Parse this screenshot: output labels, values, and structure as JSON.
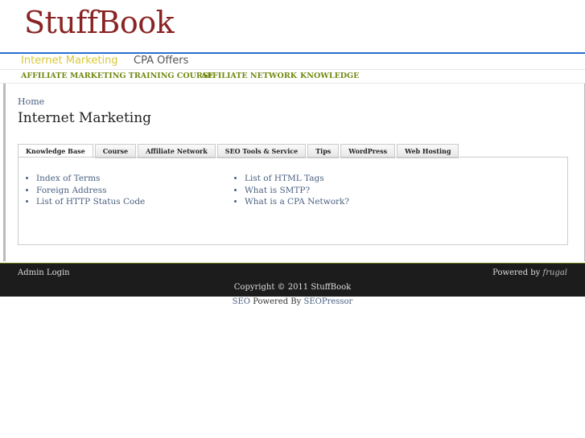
{
  "site": {
    "logo": "StuffBook"
  },
  "nav_primary": [
    {
      "label": "Internet Marketing",
      "active": true
    },
    {
      "label": "CPA Offers"
    }
  ],
  "nav_secondary": [
    "AFFILIATE MARKETING TRAINING COURSE",
    "AFFILIATE NETWORK",
    "KNOWLEDGE"
  ],
  "breadcrumb": "Home",
  "page_title": "Internet Marketing",
  "tabs": [
    "Knowledge Base",
    "Course",
    "Affiliate Network",
    "SEO Tools & Service",
    "Tips",
    "WordPress",
    "Web Hosting"
  ],
  "links_left": [
    "Index of Terms",
    "Foreign Address",
    "List of HTTP Status Code"
  ],
  "links_right": [
    "List of HTML Tags",
    "What is SMTP?",
    "What is a CPA Network?"
  ],
  "footer": {
    "admin": "Admin Login",
    "powered": "Powered by",
    "theme": "frugal",
    "copyright": "Copyright © 2011 StuffBook"
  },
  "credit": {
    "seo": "SEO",
    "mid": "Powered By",
    "seopressor": "SEOPressor"
  }
}
